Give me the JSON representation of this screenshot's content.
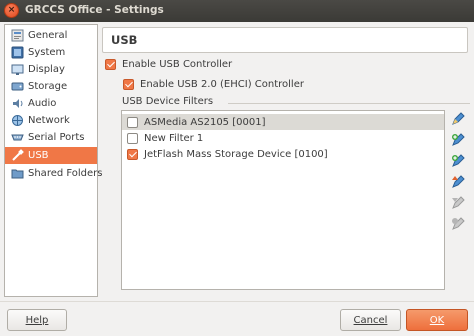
{
  "window": {
    "title": "GRCCS Office - Settings",
    "close_glyph": "×"
  },
  "sidebar": {
    "items": [
      {
        "label": "General",
        "icon": "general-icon"
      },
      {
        "label": "System",
        "icon": "system-icon"
      },
      {
        "label": "Display",
        "icon": "display-icon"
      },
      {
        "label": "Storage",
        "icon": "storage-icon"
      },
      {
        "label": "Audio",
        "icon": "audio-icon"
      },
      {
        "label": "Network",
        "icon": "network-icon"
      },
      {
        "label": "Serial Ports",
        "icon": "serial-ports-icon"
      },
      {
        "label": "USB",
        "icon": "usb-icon",
        "selected": true
      },
      {
        "label": "Shared Folders",
        "icon": "shared-folders-icon"
      }
    ]
  },
  "page": {
    "title": "USB"
  },
  "options": {
    "enable_usb": {
      "label": "Enable USB Controller",
      "checked": true
    },
    "enable_usb2": {
      "label": "Enable USB 2.0 (EHCI) Controller",
      "checked": true
    }
  },
  "filters": {
    "label": "USB Device Filters",
    "items": [
      {
        "label": "ASMedia AS2105 [0001]",
        "checked": false
      },
      {
        "label": "New Filter 1",
        "checked": false
      },
      {
        "label": "JetFlash Mass Storage Device [0100]",
        "checked": true
      }
    ],
    "tools": [
      {
        "icon": "edit-filter-icon",
        "enabled": true
      },
      {
        "icon": "add-filter-icon",
        "enabled": true
      },
      {
        "icon": "add-from-device-icon",
        "enabled": true
      },
      {
        "icon": "move-up-icon",
        "enabled": true
      },
      {
        "icon": "move-down-icon",
        "enabled": false
      },
      {
        "icon": "remove-filter-icon",
        "enabled": false
      }
    ]
  },
  "buttons": {
    "help": "Help",
    "cancel": "Cancel",
    "ok": "OK"
  },
  "colors": {
    "accent": "#f07746",
    "title_bar": "#3b3a36",
    "background": "#f2f1f0"
  }
}
